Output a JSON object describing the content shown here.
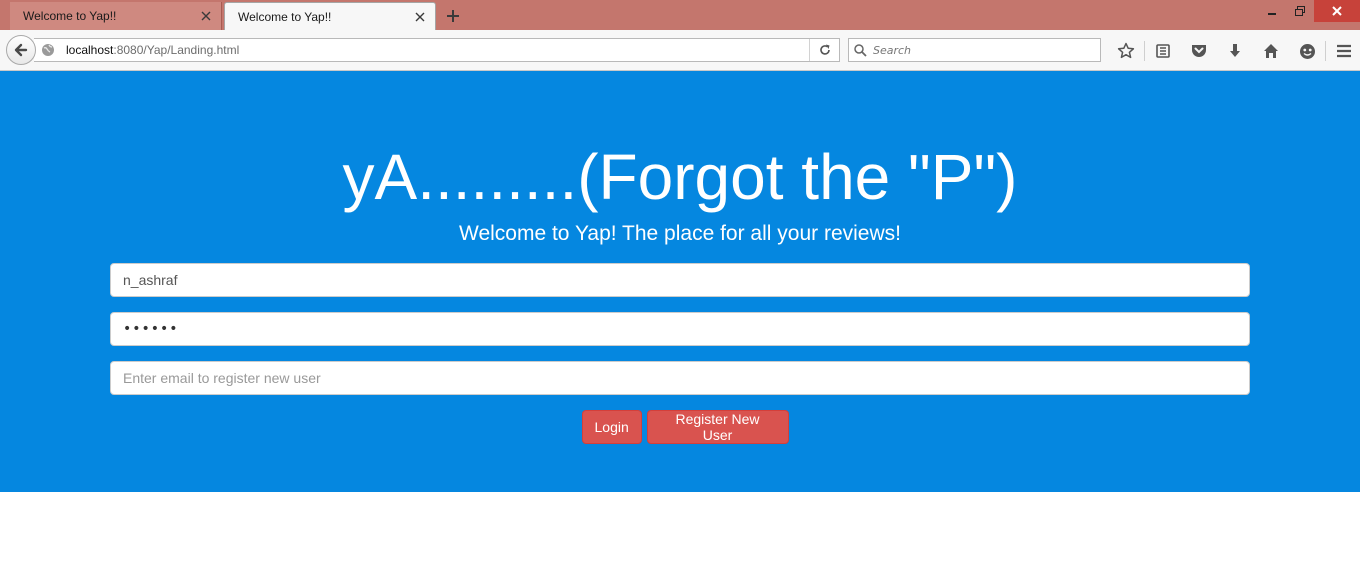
{
  "browser": {
    "tabs": [
      {
        "title": "Welcome to Yap!!",
        "active": false
      },
      {
        "title": "Welcome to Yap!!",
        "active": true
      }
    ],
    "url_host": "localhost",
    "url_rest": ":8080/Yap/Landing.html",
    "search_placeholder": "Search",
    "colors": {
      "tabstrip": "#c4766d",
      "close_button": "#c7423a"
    }
  },
  "page": {
    "title": "yA.........(Forgot the \"P\")",
    "tagline": "Welcome to Yap! The place for all your reviews!",
    "username_value": "n_ashraf",
    "password_value": "••••••",
    "email_placeholder": "Enter email to register new user",
    "login_label": "Login",
    "register_label": "Register New User",
    "colors": {
      "background": "#0587e0",
      "button": "#d9534f",
      "text": "#ffffff"
    }
  }
}
